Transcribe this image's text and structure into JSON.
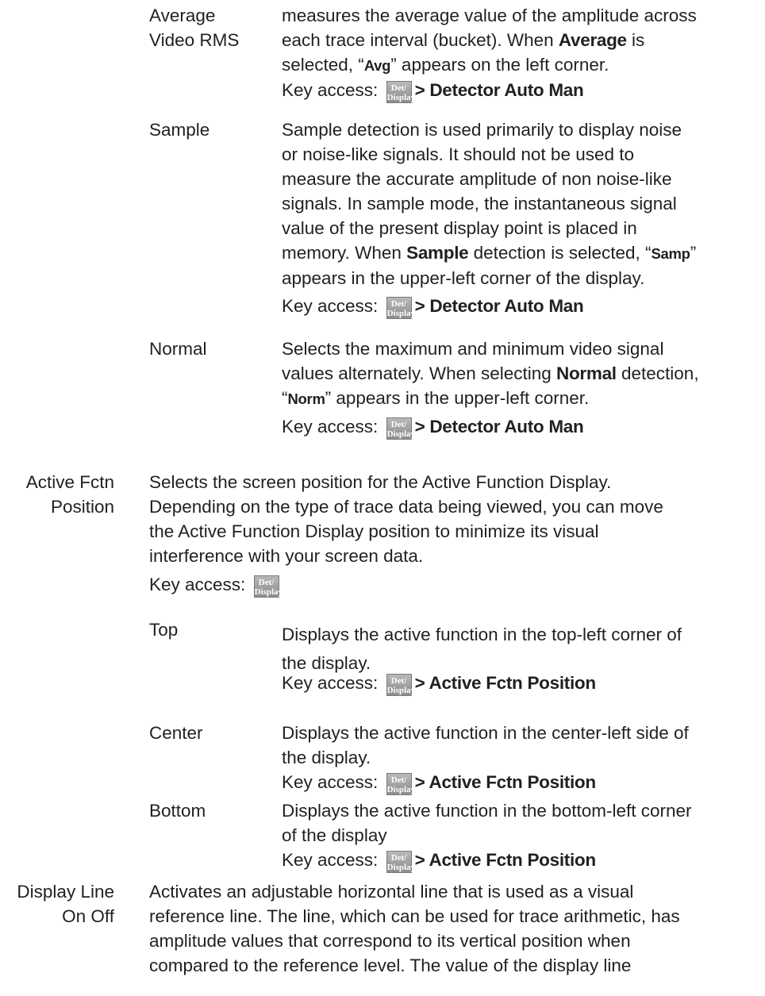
{
  "key": {
    "line1": "Det/",
    "line2": "Display"
  },
  "detectors": {
    "average": {
      "term_l1": "Average",
      "term_l2": "Video RMS",
      "d1": "measures the average value of the amplitude across",
      "d2_a": "each trace interval (bucket). When ",
      "d2_b": "Average",
      "d2_c": " is",
      "d3_a": "selected, “",
      "d3_b": "Avg",
      "d3_c": "” appears on the left corner.",
      "key_prefix": "Key access: ",
      "key_path": "> Detector Auto Man"
    },
    "sample": {
      "term": "Sample",
      "l1": "Sample detection is used primarily to display noise",
      "l2": "or noise-like signals. It should not be used to",
      "l3": "measure the accurate amplitude of non noise-like",
      "l4": "signals. In sample mode, the instantaneous signal",
      "l5": "value of the present display point is placed in",
      "l6_a": "memory. When ",
      "l6_b": "Sample",
      "l6_c": " detection is selected, “",
      "l6_d": "Samp",
      "l6_e": "”",
      "l7": "appears in the upper-left corner of the display.",
      "key_prefix": "Key access: ",
      "key_path": "> Detector Auto Man"
    },
    "normal": {
      "term": "Normal",
      "l1": "Selects the maximum and minimum video signal",
      "l2_a": "values alternately. When selecting ",
      "l2_b": "Normal",
      "l2_c": " detection,",
      "l3_a": "“",
      "l3_b": "Norm",
      "l3_c": "” appears in the upper-left corner.",
      "key_prefix": "Key access: ",
      "key_path": "> Detector Auto Man"
    }
  },
  "active_fctn": {
    "term_l1": "Active Fctn",
    "term_l2": "Position",
    "l1": "Selects the screen position for the Active Function Display.",
    "l2": "Depending on the type of trace data being viewed, you can move",
    "l3": "the Active Function Display position to minimize its visual",
    "l4": "interference with your screen data.",
    "key_prefix": "Key access: ",
    "options": [
      {
        "term": "Top",
        "l1": "Displays the active function in the top-left corner of",
        "l2": "the display.",
        "key_prefix": "Key access: ",
        "key_path": "> Active Fctn Position"
      },
      {
        "term": "Center",
        "l1": "Displays the active function in the center-left side of",
        "l2": "the display.",
        "key_prefix": "Key access: ",
        "key_path": "> Active Fctn Position"
      },
      {
        "term": "Bottom",
        "l1": "Displays the active function in the bottom-left corner",
        "l2": "of the display",
        "key_prefix": "Key access: ",
        "key_path": "> Active Fctn Position"
      }
    ]
  },
  "display_line": {
    "term_l1": "Display Line",
    "term_l2": "On Off",
    "l1": "Activates an adjustable horizontal line that is used as a visual",
    "l2": "reference line. The line, which can be used for trace arithmetic, has",
    "l3": "amplitude values that correspond to its vertical position when",
    "l4": "compared to the reference level. The value of the display line"
  }
}
